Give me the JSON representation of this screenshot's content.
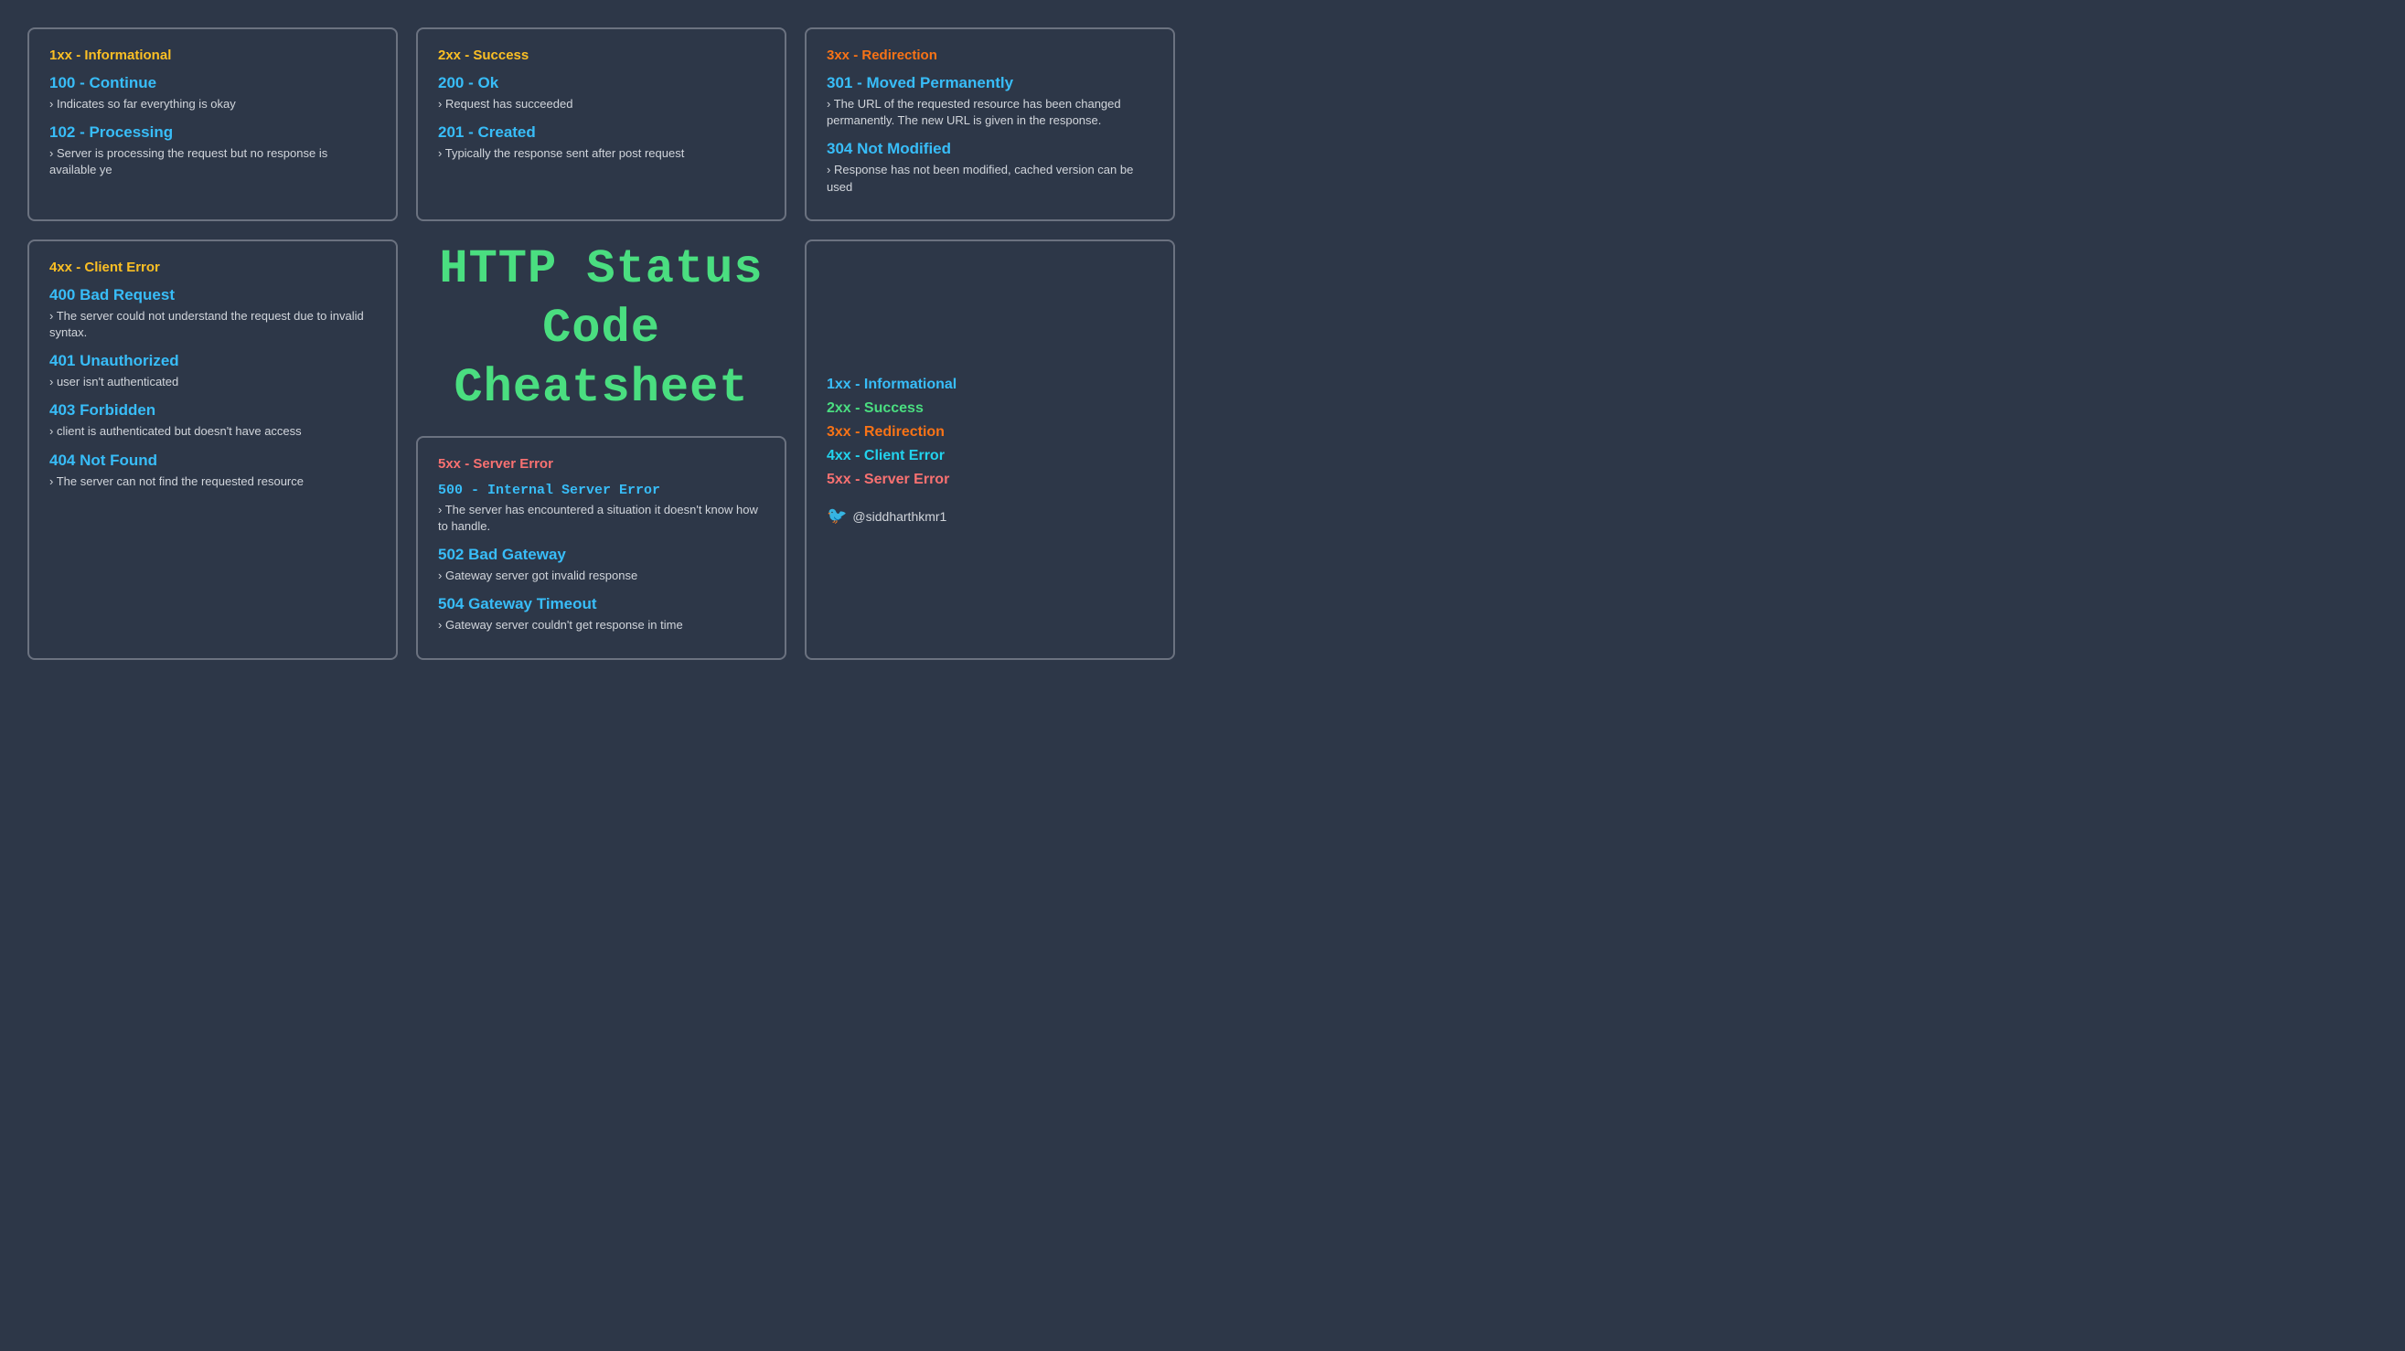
{
  "cards": {
    "1xx": {
      "category_label": "1xx - Informational",
      "codes": [
        {
          "code": "100 - Continue",
          "desc": "Indicates so far everything is okay"
        },
        {
          "code": "102 - Processing",
          "desc": "Server is processing the request but no response is available ye"
        }
      ]
    },
    "2xx": {
      "category_label": "2xx - Success",
      "codes": [
        {
          "code": "200 - Ok",
          "desc": "Request has succeeded"
        },
        {
          "code": "201 - Created",
          "desc": "Typically the response sent after post request"
        }
      ]
    },
    "3xx": {
      "category_label": "3xx - Redirection",
      "codes": [
        {
          "code": "301 - Moved Permanently",
          "desc": "The URL of the requested resource has been changed permanently. The new URL is given in the response."
        },
        {
          "code": "304 Not Modified",
          "desc": "Response has not been modified, cached version can be used"
        }
      ]
    },
    "4xx": {
      "category_label": "4xx - Client Error",
      "codes": [
        {
          "code": "400 Bad Request",
          "desc": "The server could not understand the request due to invalid syntax."
        },
        {
          "code": "401 Unauthorized",
          "desc": "user isn't authenticated"
        },
        {
          "code": "403 Forbidden",
          "desc": "client is authenticated but doesn't have access"
        },
        {
          "code": "404 Not Found",
          "desc": "The server can not find the requested resource"
        }
      ]
    },
    "5xx": {
      "category_label": "5xx - Server Error",
      "codes": [
        {
          "code": "500 - Internal Server Error",
          "desc": "The server has encountered a situation it doesn't know how to handle."
        },
        {
          "code": "502 Bad Gateway",
          "desc": "Gateway server got invalid response"
        },
        {
          "code": "504 Gateway Timeout",
          "desc": "Gateway server couldn't get response in time"
        }
      ]
    }
  },
  "title": {
    "line1": "HTTP Status Code",
    "line2": "Cheatsheet"
  },
  "legend": {
    "items": [
      {
        "label": "1xx - Informational",
        "color": "blue"
      },
      {
        "label": "2xx - Success",
        "color": "green"
      },
      {
        "label": "3xx - Redirection",
        "color": "orange"
      },
      {
        "label": "4xx - Client Error",
        "color": "cyan"
      },
      {
        "label": "5xx - Server Error",
        "color": "red"
      }
    ],
    "twitter": "@siddharthkmr1"
  }
}
